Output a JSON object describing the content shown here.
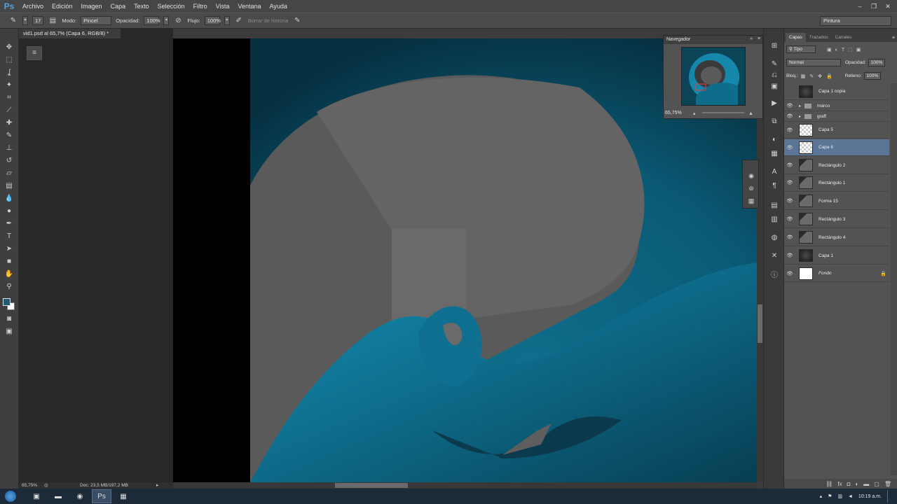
{
  "app": {
    "logo": "Ps"
  },
  "menu": [
    "Archivo",
    "Edición",
    "Imagen",
    "Capa",
    "Texto",
    "Selección",
    "Filtro",
    "Vista",
    "Ventana",
    "Ayuda"
  ],
  "options": {
    "brush_size": "17",
    "mode_label": "Modo:",
    "mode_value": "Pincel",
    "opacity_label": "Opacidad:",
    "opacity_value": "100%",
    "flow_label": "Flujo:",
    "flow_value": "100%",
    "erase_history": "Borrar de historia",
    "workspace": "Pintura"
  },
  "document": {
    "tab_title": "vid1.psd al 65,7% (Capa 6, RGB/8) *",
    "zoom": "65,75%",
    "doc_size": "Doc: 23,5 MB/197,2 MB"
  },
  "navigator": {
    "title": "Navegador",
    "zoom": "65,75%"
  },
  "layers_panel": {
    "tabs": [
      "Capas",
      "Trazados",
      "Canales"
    ],
    "filter": "Tipo",
    "blend_mode": "Normal",
    "opacity_label": "Opacidad:",
    "opacity_value": "100%",
    "lock_label": "Bloq.:",
    "fill_label": "Relleno:",
    "fill_value": "100%",
    "layers": [
      {
        "name": "Capa 1 copia",
        "visible": false,
        "thumb": "dark"
      },
      {
        "name": "marco",
        "visible": true,
        "thumb": "folder"
      },
      {
        "name": "graff",
        "visible": true,
        "thumb": "folder"
      },
      {
        "name": "Capa 5",
        "visible": true,
        "thumb": "checker"
      },
      {
        "name": "Capa 6",
        "visible": true,
        "thumb": "checker",
        "selected": true
      },
      {
        "name": "Rectángulo 2",
        "visible": true,
        "thumb": "shape"
      },
      {
        "name": "Rectángulo 1",
        "visible": true,
        "thumb": "shape"
      },
      {
        "name": "Forma 15",
        "visible": true,
        "thumb": "shape"
      },
      {
        "name": "Rectángulo 3",
        "visible": true,
        "thumb": "shape"
      },
      {
        "name": "Rectángulo 4",
        "visible": true,
        "thumb": "shape"
      },
      {
        "name": "Capa 1",
        "visible": true,
        "thumb": "dark"
      },
      {
        "name": "Fondo",
        "visible": true,
        "thumb": "white",
        "locked": true
      }
    ]
  },
  "taskbar": {
    "time": "10:19 a.m."
  },
  "colors": {
    "foreground": "#1d5d73",
    "background": "#ffffff",
    "accent_teal": "#137a9a"
  }
}
